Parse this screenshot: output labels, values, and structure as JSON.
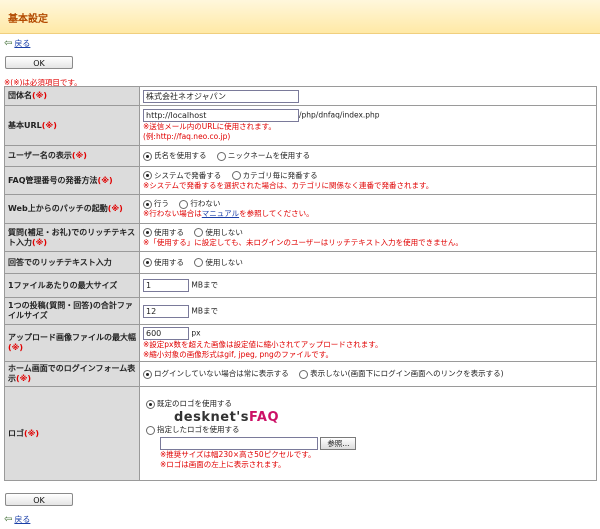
{
  "header": {
    "title": "基本設定"
  },
  "nav": {
    "back_label": "戻る"
  },
  "buttons": {
    "ok_label": "OK"
  },
  "required_note": "※(※)は必須項目です。",
  "required_mark": "(※)",
  "fields": {
    "org": {
      "label": "団体名",
      "value": "株式会社ネオジャパン"
    },
    "url": {
      "label": "基本URL",
      "value": "http://localhost",
      "suffix": "/php/dnfaq/index.php",
      "note1": "※送信メール内のURLに使用されます。",
      "note2": "(例:http://faq.neo.co.jp)"
    },
    "username": {
      "label": "ユーザー名の表示",
      "opt1": "氏名を使用する",
      "opt2": "ニックネームを使用する"
    },
    "faqnum": {
      "label": "FAQ管理番号の発番方法",
      "opt1": "システムで発番する",
      "opt2": "カテゴリ毎に発番する",
      "note": "※システムで発番するを選択された場合は、カテゴリに関係なく連番で発番されます。"
    },
    "patch": {
      "label": "Web上からのパッチの起動",
      "opt1": "行う",
      "opt2": "行わない",
      "note_pre": "※行わない場合は",
      "note_link": "マニュアル",
      "note_post": "を参照してください。"
    },
    "richq": {
      "label": "質問(補足・お礼)でのリッチテキスト入力",
      "opt1": "使用する",
      "opt2": "使用しない",
      "note": "※「使用する」に設定しても、未ログインのユーザーはリッチテキスト入力を使用できません。"
    },
    "richa": {
      "label": "回答でのリッチテキスト入力",
      "opt1": "使用する",
      "opt2": "使用しない"
    },
    "filemax": {
      "label": "1ファイルあたりの最大サイズ",
      "value": "1",
      "unit": "MBまで"
    },
    "totalmax": {
      "label": "1つの投稿(質問・回答)の合計ファイルサイズ",
      "value": "12",
      "unit": "MBまで"
    },
    "imgwidth": {
      "label": "アップロード画像ファイルの最大幅",
      "value": "600",
      "unit": "px",
      "note1": "※設定px数を超えた画像は設定値に縮小されてアップロードされます。",
      "note2": "※縮小対象の画像形式はgif, jpeg, pngのファイルです。"
    },
    "loginform": {
      "label": "ホーム画面でのログインフォーム表示",
      "opt1": "ログインしていない場合は常に表示する",
      "opt2": "表示しない(画面下にログイン画面へのリンクを表示する)"
    },
    "logo": {
      "label": "ロゴ",
      "opt1": "既定のロゴを使用する",
      "logo_text_a": "desknet's",
      "logo_text_b": "FAQ",
      "opt2": "指定したロゴを使用する",
      "browse_label": "参照...",
      "note1": "※推奨サイズは幅230×高さ50ピクセルです。",
      "note2": "※ロゴは画面の左上に表示されます。"
    }
  },
  "colors": {
    "header_bg": "#ffe9a6",
    "title": "#b34a00",
    "required": "#e00000",
    "label_bg": "#dcdcdc"
  }
}
